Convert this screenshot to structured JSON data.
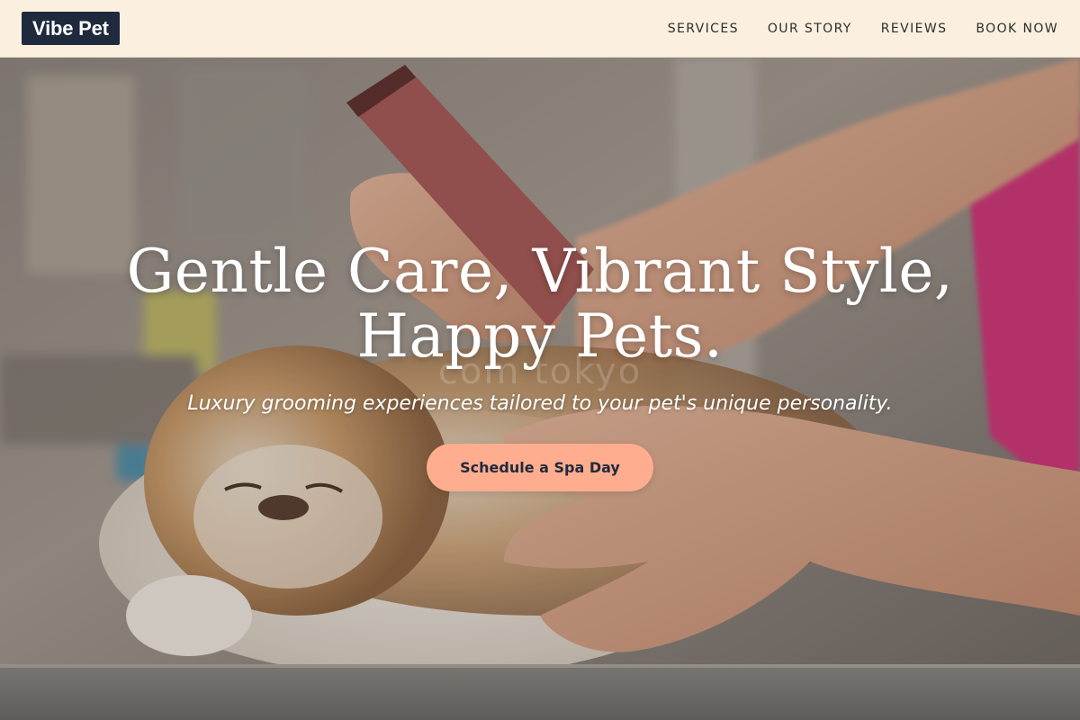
{
  "header": {
    "logo": "Vibe Pet",
    "nav": [
      {
        "label": "SERVICES"
      },
      {
        "label": "OUR STORY"
      },
      {
        "label": "REVIEWS"
      },
      {
        "label": "BOOK NOW"
      }
    ]
  },
  "hero": {
    "headline_line1": "Gentle Care, Vibrant Style,",
    "headline_line2": "Happy Pets.",
    "subtitle": "Luxury grooming experiences tailored to your pet's unique personality.",
    "cta_label": "Schedule a Spa Day",
    "watermark": "com tokyo"
  },
  "colors": {
    "header_bg": "#fbf0df",
    "logo_bg": "#1f2a3d",
    "cta_bg": "#ffad8e",
    "nav_text": "#2d2d2d"
  }
}
